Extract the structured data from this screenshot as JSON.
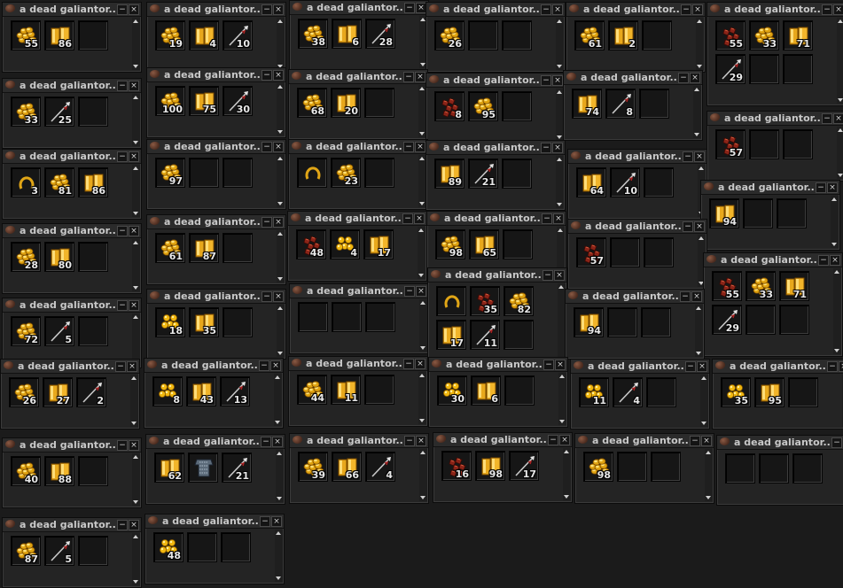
{
  "loot_windows": [
    {
      "title": "a dead galiantor...",
      "items": [
        {
          "icon": "gold-ingot-stack-icon",
          "count": "55"
        },
        {
          "icon": "gold-bars-icon",
          "count": "86"
        },
        {
          "icon": "",
          "count": ""
        }
      ]
    },
    {
      "title": "a dead galiantor...",
      "items": [
        {
          "icon": "gold-ingot-stack-icon",
          "count": "19"
        },
        {
          "icon": "gold-bars-icon",
          "count": "4"
        },
        {
          "icon": "spear-icon",
          "count": "10"
        }
      ]
    },
    {
      "title": "a dead galiantor...",
      "items": [
        {
          "icon": "gold-ingot-stack-icon",
          "count": "38"
        },
        {
          "icon": "gold-bars-icon",
          "count": "6"
        },
        {
          "icon": "spear-icon",
          "count": "28"
        }
      ]
    },
    {
      "title": "a dead galiantor...",
      "items": [
        {
          "icon": "gold-ingot-stack-icon",
          "count": "26"
        },
        {
          "icon": "",
          "count": ""
        },
        {
          "icon": "",
          "count": ""
        }
      ]
    },
    {
      "title": "a dead galiantor...",
      "items": [
        {
          "icon": "gold-ingot-stack-icon",
          "count": "61"
        },
        {
          "icon": "gold-bars-icon",
          "count": "2"
        },
        {
          "icon": "",
          "count": ""
        }
      ]
    },
    {
      "title": "a dead galiantor...",
      "items": [
        {
          "icon": "red-scales-icon",
          "count": "55"
        },
        {
          "icon": "gold-ingot-stack-icon",
          "count": "33"
        },
        {
          "icon": "gold-bars-icon",
          "count": "71"
        },
        {
          "icon": "spear-icon",
          "count": "29"
        }
      ]
    },
    {
      "title": "a dead galiantor...",
      "items": [
        {
          "icon": "gold-ingot-stack-icon",
          "count": "33"
        },
        {
          "icon": "spear-icon",
          "count": "25"
        },
        {
          "icon": "",
          "count": ""
        }
      ]
    },
    {
      "title": "a dead galiantor...",
      "items": [
        {
          "icon": "gold-ingot-stack-icon",
          "count": "100"
        },
        {
          "icon": "gold-bars-icon",
          "count": "75"
        },
        {
          "icon": "spear-icon",
          "count": "30"
        }
      ]
    },
    {
      "title": "a dead galiantor...",
      "items": [
        {
          "icon": "gold-ingot-stack-icon",
          "count": "68"
        },
        {
          "icon": "gold-bars-icon",
          "count": "20"
        },
        {
          "icon": "",
          "count": ""
        }
      ]
    },
    {
      "title": "a dead galiantor...",
      "items": [
        {
          "icon": "red-scales-icon",
          "count": "8"
        },
        {
          "icon": "gold-ingot-stack-icon",
          "count": "95"
        },
        {
          "icon": "",
          "count": ""
        }
      ]
    },
    {
      "title": "a dead galiantor...",
      "items": [
        {
          "icon": "gold-bars-icon",
          "count": "74"
        },
        {
          "icon": "spear-icon",
          "count": "8"
        },
        {
          "icon": "",
          "count": ""
        }
      ]
    },
    {
      "title": "a dead galiantor...",
      "items": [
        {
          "icon": "red-scales-icon",
          "count": "57"
        },
        {
          "icon": "",
          "count": ""
        },
        {
          "icon": "",
          "count": ""
        }
      ]
    },
    {
      "title": "a dead galiantor...",
      "items": [
        {
          "icon": "horseshoe-icon",
          "count": "3"
        },
        {
          "icon": "gold-ingot-stack-icon",
          "count": "81"
        },
        {
          "icon": "gold-bars-icon",
          "count": "86"
        }
      ]
    },
    {
      "title": "a dead galiantor...",
      "items": [
        {
          "icon": "gold-ingot-stack-icon",
          "count": "97"
        },
        {
          "icon": "",
          "count": ""
        },
        {
          "icon": "",
          "count": ""
        }
      ]
    },
    {
      "title": "a dead galiantor...",
      "items": [
        {
          "icon": "horseshoe-icon",
          "count": ""
        },
        {
          "icon": "gold-ingot-stack-icon",
          "count": "23"
        },
        {
          "icon": "",
          "count": ""
        }
      ]
    },
    {
      "title": "a dead galiantor...",
      "items": [
        {
          "icon": "gold-bars-icon",
          "count": "89"
        },
        {
          "icon": "spear-icon",
          "count": "21"
        },
        {
          "icon": "",
          "count": ""
        }
      ]
    },
    {
      "title": "a dead galiantor...",
      "items": [
        {
          "icon": "gold-bars-icon",
          "count": "64"
        },
        {
          "icon": "spear-icon",
          "count": "10"
        },
        {
          "icon": "",
          "count": ""
        }
      ]
    },
    {
      "title": "a dead galiantor...",
      "items": [
        {
          "icon": "gold-bars-icon",
          "count": "94"
        },
        {
          "icon": "",
          "count": ""
        },
        {
          "icon": "",
          "count": ""
        }
      ]
    },
    {
      "title": "a dead galiantor...",
      "items": [
        {
          "icon": "gold-ingot-stack-icon",
          "count": "28"
        },
        {
          "icon": "gold-bars-icon",
          "count": "80"
        },
        {
          "icon": "",
          "count": ""
        }
      ]
    },
    {
      "title": "a dead galiantor...",
      "items": [
        {
          "icon": "gold-ingot-stack-icon",
          "count": "61"
        },
        {
          "icon": "gold-bars-icon",
          "count": "87"
        },
        {
          "icon": "",
          "count": ""
        }
      ]
    },
    {
      "title": "a dead galiantor...",
      "items": [
        {
          "icon": "red-scales-icon",
          "count": "48"
        },
        {
          "icon": "gold-coins-icon",
          "count": "4"
        },
        {
          "icon": "gold-bars-icon",
          "count": "17"
        }
      ]
    },
    {
      "title": "a dead galiantor...",
      "items": [
        {
          "icon": "gold-ingot-stack-icon",
          "count": "98"
        },
        {
          "icon": "gold-bars-icon",
          "count": "65"
        },
        {
          "icon": "",
          "count": ""
        }
      ]
    },
    {
      "title": "a dead galiantor...",
      "items": [
        {
          "icon": "red-scales-icon",
          "count": "57"
        },
        {
          "icon": "",
          "count": ""
        },
        {
          "icon": "",
          "count": ""
        }
      ]
    },
    {
      "title": "a dead galiantor...",
      "items": [
        {
          "icon": "red-scales-icon",
          "count": "55"
        },
        {
          "icon": "gold-ingot-stack-icon",
          "count": "33"
        },
        {
          "icon": "gold-bars-icon",
          "count": "71"
        },
        {
          "icon": "spear-icon",
          "count": "29"
        }
      ]
    },
    {
      "title": "a dead galiantor...",
      "items": [
        {
          "icon": "gold-ingot-stack-icon",
          "count": "72"
        },
        {
          "icon": "spear-icon",
          "count": "5"
        },
        {
          "icon": "",
          "count": ""
        }
      ]
    },
    {
      "title": "a dead galiantor...",
      "items": [
        {
          "icon": "gold-coins-icon",
          "count": "18"
        },
        {
          "icon": "gold-bars-icon",
          "count": "35"
        },
        {
          "icon": "",
          "count": ""
        }
      ]
    },
    {
      "title": "a dead galiantor...",
      "items": [
        {
          "icon": "",
          "count": ""
        },
        {
          "icon": "",
          "count": ""
        },
        {
          "icon": "",
          "count": ""
        }
      ]
    },
    {
      "title": "a dead galiantor...",
      "items": [
        {
          "icon": "horseshoe-icon",
          "count": ""
        },
        {
          "icon": "red-scales-icon",
          "count": "35"
        },
        {
          "icon": "gold-ingot-stack-icon",
          "count": "82"
        },
        {
          "icon": "gold-bars-icon",
          "count": "17"
        },
        {
          "icon": "spear-icon",
          "count": "11"
        }
      ]
    },
    {
      "title": "a dead galiantor...",
      "items": [
        {
          "icon": "gold-bars-icon",
          "count": "94"
        },
        {
          "icon": "",
          "count": ""
        },
        {
          "icon": "",
          "count": ""
        }
      ]
    },
    {
      "title": "a dead galiantor...",
      "items": [
        {
          "icon": "gold-ingot-stack-icon",
          "count": "26"
        },
        {
          "icon": "gold-bars-icon",
          "count": "27"
        },
        {
          "icon": "spear-icon",
          "count": "2"
        }
      ]
    },
    {
      "title": "a dead galiantor...",
      "items": [
        {
          "icon": "gold-coins-icon",
          "count": "8"
        },
        {
          "icon": "gold-bars-icon",
          "count": "43"
        },
        {
          "icon": "spear-icon",
          "count": "13"
        }
      ]
    },
    {
      "title": "a dead galiantor...",
      "items": [
        {
          "icon": "gold-ingot-stack-icon",
          "count": "44"
        },
        {
          "icon": "gold-bars-icon",
          "count": "11"
        },
        {
          "icon": "",
          "count": ""
        }
      ]
    },
    {
      "title": "a dead galiantor...",
      "items": [
        {
          "icon": "gold-coins-icon",
          "count": "30"
        },
        {
          "icon": "gold-bars-icon",
          "count": "6"
        },
        {
          "icon": "",
          "count": ""
        }
      ]
    },
    {
      "title": "a dead galiantor...",
      "items": [
        {
          "icon": "gold-coins-icon",
          "count": "11"
        },
        {
          "icon": "spear-icon",
          "count": "4"
        },
        {
          "icon": "",
          "count": ""
        }
      ]
    },
    {
      "title": "a dead galiantor...",
      "items": [
        {
          "icon": "gold-coins-icon",
          "count": "35"
        },
        {
          "icon": "gold-bars-icon",
          "count": "95"
        },
        {
          "icon": "",
          "count": ""
        }
      ]
    },
    {
      "title": "a dead galiantor...",
      "items": [
        {
          "icon": "gold-ingot-stack-icon",
          "count": "40"
        },
        {
          "icon": "gold-bars-icon",
          "count": "88"
        },
        {
          "icon": "",
          "count": ""
        }
      ]
    },
    {
      "title": "a dead galiantor...",
      "items": [
        {
          "icon": "gold-bars-icon",
          "count": "62"
        },
        {
          "icon": "chain-armor-icon",
          "count": ""
        },
        {
          "icon": "spear-icon",
          "count": "21"
        }
      ]
    },
    {
      "title": "a dead galiantor...",
      "items": [
        {
          "icon": "gold-ingot-stack-icon",
          "count": "39"
        },
        {
          "icon": "gold-bars-icon",
          "count": "66"
        },
        {
          "icon": "spear-icon",
          "count": "4"
        }
      ]
    },
    {
      "title": "a dead galiantor...",
      "items": [
        {
          "icon": "red-scales-icon",
          "count": "16"
        },
        {
          "icon": "gold-bars-icon",
          "count": "98"
        },
        {
          "icon": "spear-icon",
          "count": "17"
        }
      ]
    },
    {
      "title": "a dead galiantor...",
      "items": [
        {
          "icon": "gold-ingot-stack-icon",
          "count": "98"
        },
        {
          "icon": "",
          "count": ""
        },
        {
          "icon": "",
          "count": ""
        }
      ]
    },
    {
      "title": "a dead galiantor...",
      "items": [
        {
          "icon": "",
          "count": ""
        },
        {
          "icon": "",
          "count": ""
        },
        {
          "icon": "",
          "count": ""
        }
      ]
    },
    {
      "title": "a dead galiantor...",
      "items": [
        {
          "icon": "gold-ingot-stack-icon",
          "count": "87"
        },
        {
          "icon": "spear-icon",
          "count": "5"
        },
        {
          "icon": "",
          "count": ""
        }
      ]
    },
    {
      "title": "a dead galiantor...",
      "items": [
        {
          "icon": "gold-coins-icon",
          "count": "48"
        },
        {
          "icon": "",
          "count": ""
        },
        {
          "icon": "",
          "count": ""
        }
      ]
    }
  ],
  "buttons": {
    "minimize": "−",
    "close": "×"
  }
}
